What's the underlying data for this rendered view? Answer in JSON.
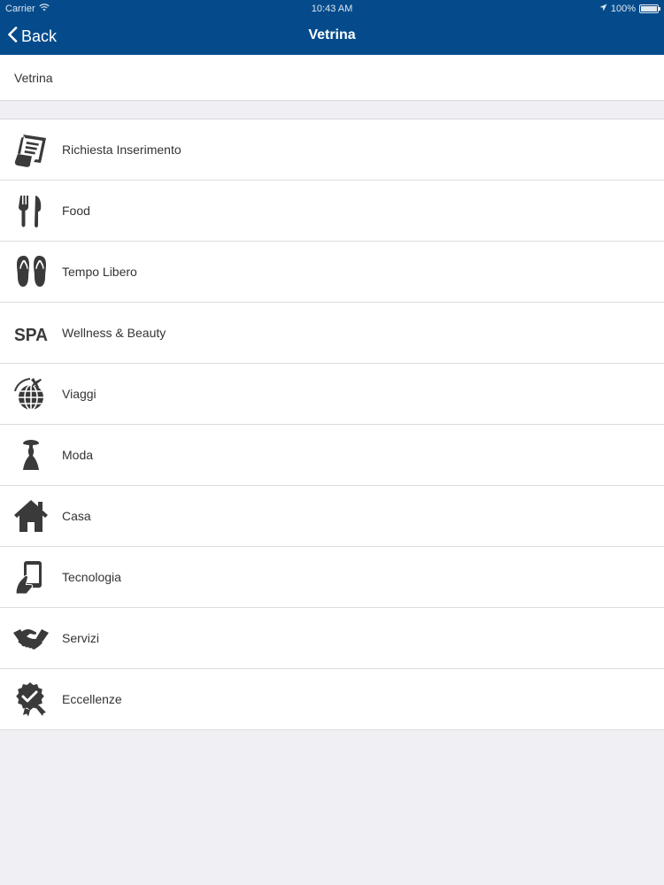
{
  "status": {
    "carrier": "Carrier",
    "time": "10:43 AM",
    "battery": "100%"
  },
  "nav": {
    "back_label": "Back",
    "title": "Vetrina"
  },
  "section": {
    "label": "Vetrina"
  },
  "items": [
    {
      "label": "Richiesta Inserimento",
      "icon": "document-list-icon"
    },
    {
      "label": "Food",
      "icon": "fork-knife-icon"
    },
    {
      "label": "Tempo Libero",
      "icon": "flip-flops-icon"
    },
    {
      "label": "Wellness & Beauty",
      "icon": "spa-icon",
      "icon_text": "SPA"
    },
    {
      "label": "Viaggi",
      "icon": "globe-plane-icon"
    },
    {
      "label": "Moda",
      "icon": "dress-icon"
    },
    {
      "label": "Casa",
      "icon": "house-icon"
    },
    {
      "label": "Tecnologia",
      "icon": "phone-hand-icon"
    },
    {
      "label": "Servizi",
      "icon": "handshake-icon"
    },
    {
      "label": "Eccellenze",
      "icon": "badge-check-icon"
    }
  ],
  "colors": {
    "nav_background": "#054b8b",
    "icon_color": "#3a3a3a",
    "background": "#efeff4"
  }
}
